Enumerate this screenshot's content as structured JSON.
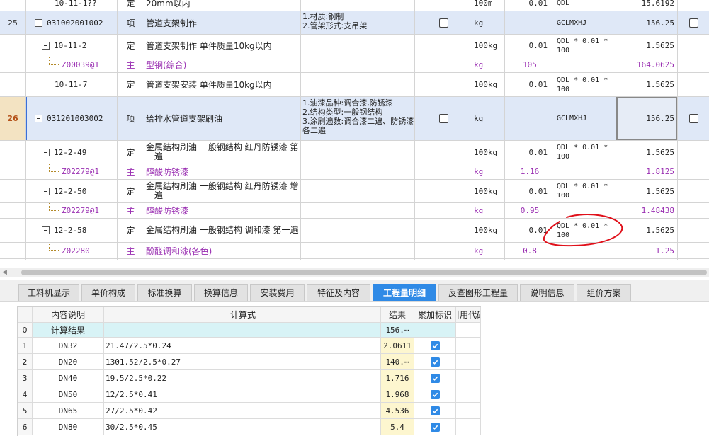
{
  "rows": [
    {
      "idx": "",
      "code": "10-11-1??",
      "type": "定",
      "name": "20mm以内",
      "unit": "100m",
      "qty": "0.01",
      "expr": "QDL",
      "total": "15.6192"
    },
    {
      "idx": "25",
      "code": "031002001002",
      "type": "项",
      "name": "管道支架制作",
      "feature": "1.材质:钢制\n2.管架形式:支吊架",
      "unit": "kg",
      "qty": "",
      "expr": "GCLMXHJ",
      "total": "156.25"
    },
    {
      "idx": "",
      "code": "10-11-2",
      "type": "定",
      "name": "管道支架制作 单件质量10kg以内",
      "unit": "100kg",
      "qty": "0.01",
      "expr": "QDL * 0.01 * 100",
      "total": "1.5625"
    },
    {
      "idx": "",
      "code": "Z00039@1",
      "type": "主",
      "name": "型钢(综合)",
      "unit": "kg",
      "qty": "105",
      "expr": "",
      "total": "164.0625"
    },
    {
      "idx": "",
      "code": "10-11-7",
      "type": "定",
      "name": "管道支架安装 单件质量10kg以内",
      "unit": "100kg",
      "qty": "0.01",
      "expr": "QDL * 0.01 * 100",
      "total": "1.5625"
    },
    {
      "idx": "26",
      "code": "031201003002",
      "type": "项",
      "name": "给排水管道支架刷油",
      "feature": "1.油漆品种:调合漆,防锈漆\n2.结构类型:一般钢结构\n3.涂刷遍数:调合漆二遍、防锈漆各二遍",
      "unit": "kg",
      "qty": "",
      "expr": "GCLMXHJ",
      "total": "156.25"
    },
    {
      "idx": "",
      "code": "12-2-49",
      "type": "定",
      "name": "金属结构刷油 一般钢结构 红丹防锈漆 第一遍",
      "unit": "100kg",
      "qty": "0.01",
      "expr": "QDL * 0.01 * 100",
      "total": "1.5625"
    },
    {
      "idx": "",
      "code": "Z02279@1",
      "type": "主",
      "name": "醇酸防锈漆",
      "unit": "kg",
      "qty": "1.16",
      "expr": "",
      "total": "1.8125"
    },
    {
      "idx": "",
      "code": "12-2-50",
      "type": "定",
      "name": "金属结构刷油 一般钢结构 红丹防锈漆 增一遍",
      "unit": "100kg",
      "qty": "0.01",
      "expr": "QDL * 0.01 * 100",
      "total": "1.5625"
    },
    {
      "idx": "",
      "code": "Z02279@1",
      "type": "主",
      "name": "醇酸防锈漆",
      "unit": "kg",
      "qty": "0.95",
      "expr": "",
      "total": "1.48438"
    },
    {
      "idx": "",
      "code": "12-2-58",
      "type": "定",
      "name": "金属结构刷油 一般钢结构 调和漆 第一遍",
      "unit": "100kg",
      "qty": "0.01",
      "expr": "QDL * 0.01 * 100",
      "total": "1.5625"
    },
    {
      "idx": "",
      "code": "Z02280",
      "type": "主",
      "name": "酚醛调和漆(各色)",
      "unit": "kg",
      "qty": "0.8",
      "expr": "",
      "total": "1.25"
    }
  ],
  "tabs": [
    "工料机显示",
    "单价构成",
    "标准换算",
    "换算信息",
    "安装费用",
    "特征及内容",
    "工程量明细",
    "反查图形工程量",
    "说明信息",
    "组价方案"
  ],
  "active_tab": "工程量明细",
  "detail": {
    "headers": {
      "desc": "内容说明",
      "expr": "计算式",
      "result": "结果",
      "flag": "累加标识",
      "ref": "引用代码"
    },
    "total_row": {
      "no": "0",
      "desc": "计算结果",
      "result": "156.⋯"
    },
    "rows": [
      {
        "no": "1",
        "desc": "DN32",
        "expr": "21.47/2.5*0.24",
        "result": "2.0611",
        "checked": true
      },
      {
        "no": "2",
        "desc": "DN20",
        "expr": "1301.52/2.5*0.27",
        "result": "140.⋯",
        "checked": true
      },
      {
        "no": "3",
        "desc": "DN40",
        "expr": "19.5/2.5*0.22",
        "result": "1.716",
        "checked": true
      },
      {
        "no": "4",
        "desc": "DN50",
        "expr": "12/2.5*0.41",
        "result": "1.968",
        "checked": true
      },
      {
        "no": "5",
        "desc": "DN65",
        "expr": "27/2.5*0.42",
        "result": "4.536",
        "checked": true
      },
      {
        "no": "6",
        "desc": "DN80",
        "expr": "30/2.5*0.45",
        "result": "5.4",
        "checked": true
      }
    ]
  },
  "colors": {
    "accent": "#2f8ae6",
    "purple": "#9a2fb2",
    "qd_row": "#dfe8f7",
    "annotation": "#e0101a"
  }
}
